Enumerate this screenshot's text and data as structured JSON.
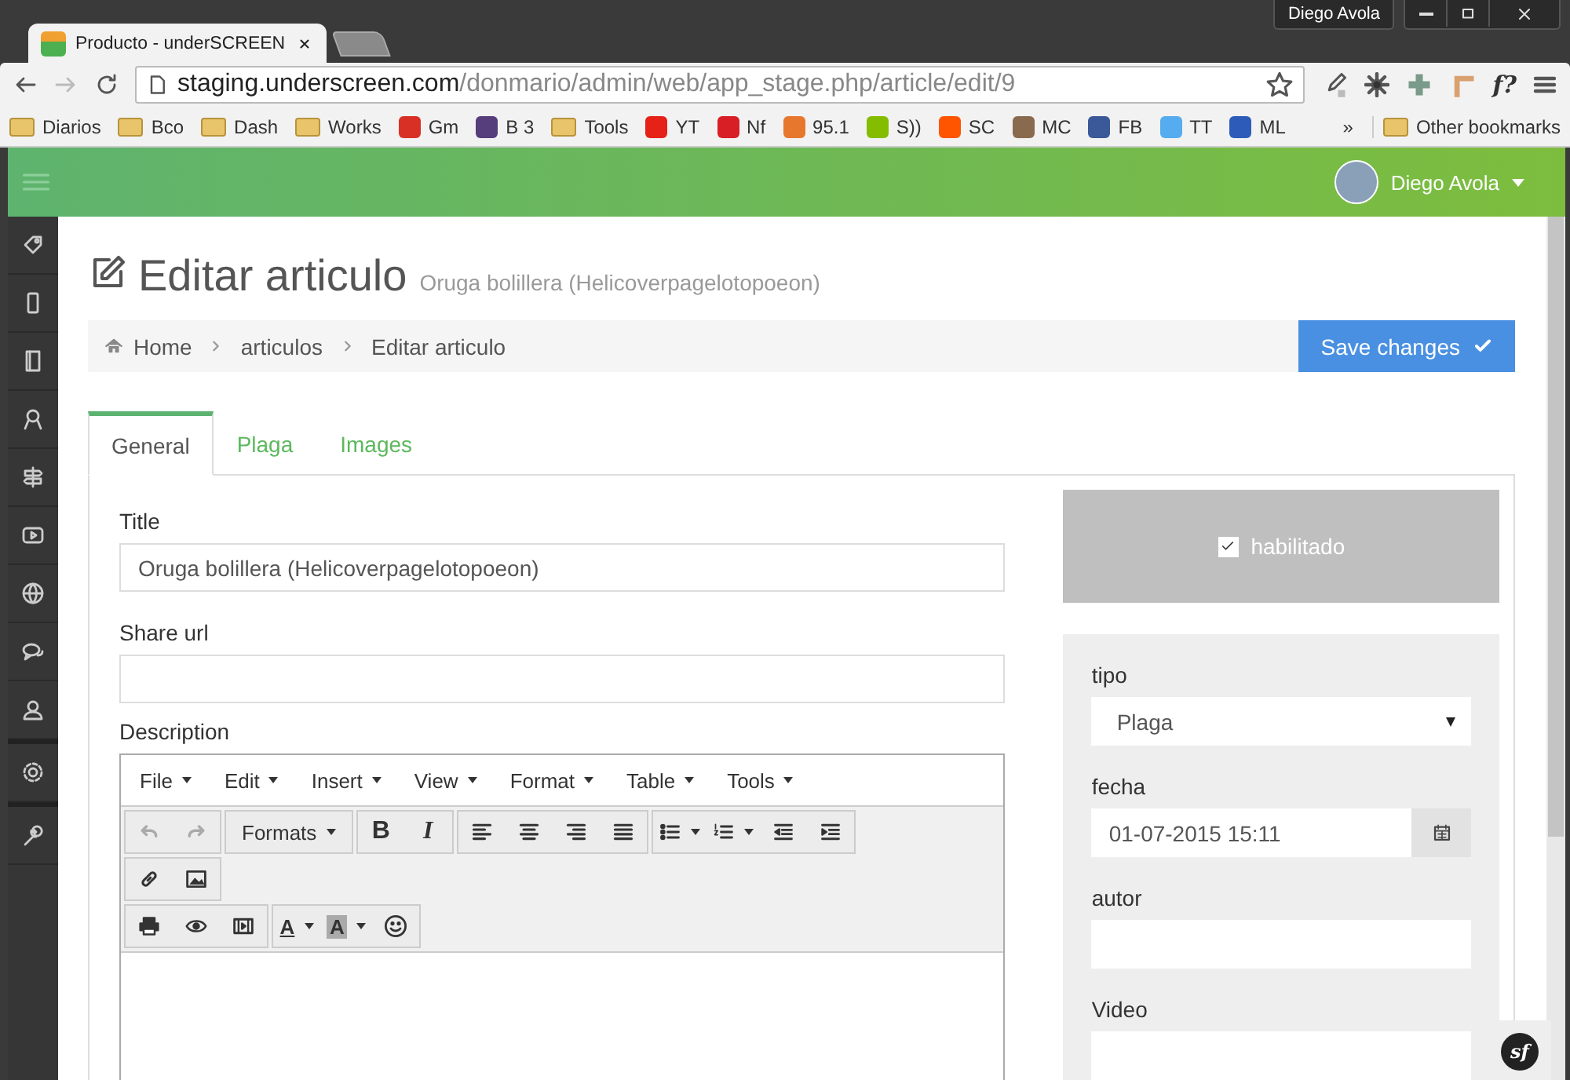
{
  "browser": {
    "tab_title": "Producto - underSCREEN",
    "profile": "Diego Avola",
    "url": {
      "host": "staging.underscreen.com",
      "path": "/donmario/admin/web/app_stage.php/article/edit/9"
    },
    "bookmarks": [
      {
        "label": "Diarios",
        "kind": "folder"
      },
      {
        "label": "Bco",
        "kind": "folder"
      },
      {
        "label": "Dash",
        "kind": "folder"
      },
      {
        "label": "Works",
        "kind": "folder"
      },
      {
        "label": "Gm",
        "kind": "site",
        "color": "#d93025"
      },
      {
        "label": "B 3",
        "kind": "site",
        "color": "#563d7c"
      },
      {
        "label": "Tools",
        "kind": "folder"
      },
      {
        "label": "YT",
        "kind": "site",
        "color": "#e62117"
      },
      {
        "label": "Nf",
        "kind": "site",
        "color": "#d81f26"
      },
      {
        "label": "95.1",
        "kind": "site",
        "color": "#e8772e"
      },
      {
        "label": "S))",
        "kind": "site",
        "color": "#84bd00"
      },
      {
        "label": "SC",
        "kind": "site",
        "color": "#ff5500"
      },
      {
        "label": "MC",
        "kind": "site",
        "color": "#8a6a4e"
      },
      {
        "label": "FB",
        "kind": "site",
        "color": "#3b5998"
      },
      {
        "label": "TT",
        "kind": "site",
        "color": "#55acee"
      },
      {
        "label": "ML",
        "kind": "site",
        "color": "#2d5bb9"
      }
    ],
    "overflow": "»",
    "other_bookmarks": "Other bookmarks",
    "ext_label": "f?"
  },
  "header": {
    "user": "Diego Avola"
  },
  "page": {
    "title": "Editar articulo",
    "subtitle": "Oruga bolillera (Helicoverpagelotopoeon)",
    "breadcrumb": [
      "Home",
      "articulos",
      "Editar articulo"
    ],
    "save_button": "Save changes",
    "tabs": [
      {
        "label": "General",
        "selected": true
      },
      {
        "label": "Plaga",
        "selected": false
      },
      {
        "label": "Images",
        "selected": false
      }
    ]
  },
  "form": {
    "title": {
      "label": "Title",
      "value": "Oruga bolillera (Helicoverpagelotopoeon)"
    },
    "share_url": {
      "label": "Share url"
    },
    "description": {
      "label": "Description"
    }
  },
  "editor": {
    "menus": [
      "File",
      "Edit",
      "Insert",
      "View",
      "Format",
      "Table",
      "Tools"
    ],
    "undo_disabled": true,
    "redo_disabled": true,
    "formats": "Formats",
    "bold": "B",
    "italic": "I",
    "text_color": "A",
    "background_color": "A"
  },
  "side": {
    "enabled": {
      "label": "habilitado",
      "checked": true
    },
    "tipo": {
      "label": "tipo",
      "value": "Plaga"
    },
    "fecha": {
      "label": "fecha",
      "value": "01-07-2015 15:11"
    },
    "autor": {
      "label": "autor"
    },
    "video": {
      "label": "Video"
    }
  },
  "debug_badge": "sf"
}
